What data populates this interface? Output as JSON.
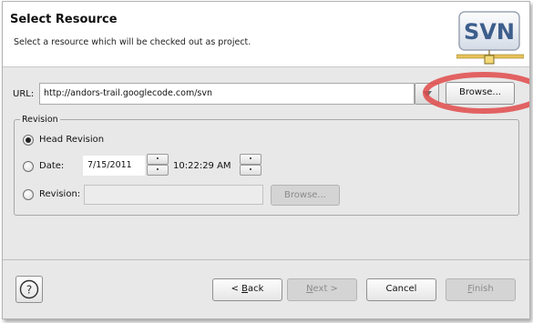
{
  "header": {
    "title": "Select Resource",
    "subtitle": "Select a resource which will be checked out as project.",
    "logo_text": "SVN"
  },
  "url": {
    "label": "URL:",
    "value": "http://andors-trail.googlecode.com/svn",
    "dropdown_icon": "chevron-down-icon",
    "browse_label": "Browse..."
  },
  "revision": {
    "group_label": "Revision",
    "head_label": "Head Revision",
    "head_selected": true,
    "date_label": "Date:",
    "date_value": "7/15/2011",
    "time_value": "10:22:29 AM",
    "revision_label": "Revision:",
    "revision_value": "",
    "revision_browse_label": "Browse..."
  },
  "footer": {
    "help_icon": "help-icon",
    "back_prefix": "< ",
    "back_key": "B",
    "back_suffix": "ack",
    "next_key": "N",
    "next_suffix": "ext >",
    "cancel_label": "Cancel",
    "finish_key": "F",
    "finish_suffix": "inish"
  },
  "colors": {
    "annotation_circle": "#e04a4a",
    "logo_text": "#3d5e8c",
    "logo_bar": "#e6c25a"
  }
}
